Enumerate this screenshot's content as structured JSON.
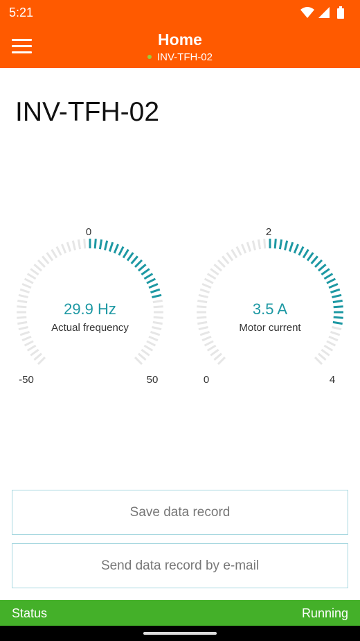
{
  "status_bar": {
    "time": "5:21",
    "icons": [
      "wifi-icon",
      "cell-signal-icon",
      "battery-icon"
    ]
  },
  "appbar": {
    "title": "Home",
    "subtitle": "INV-TFH-02",
    "menu_icon": "hamburger-menu-icon",
    "color": "#ff5a00",
    "connection_dot_color": "#9ccc3c"
  },
  "device": {
    "name": "INV-TFH-02"
  },
  "gauges": [
    {
      "id": "frequency",
      "value_text": "29.9 Hz",
      "label": "Actual frequency",
      "min": "-50",
      "max": "50",
      "mid": "0",
      "min_val": -50,
      "max_val": 50,
      "mid_val": 0,
      "value": 29.9
    },
    {
      "id": "current",
      "value_text": "3.5 A",
      "label": "Motor current",
      "min": "0",
      "max": "4",
      "mid": "2",
      "min_val": 0,
      "max_val": 4,
      "mid_val": 2,
      "value": 3.5
    }
  ],
  "colors": {
    "active_tick": "#1d98a3",
    "inactive_tick": "#e6e6e6",
    "status_green": "#44b029"
  },
  "actions": {
    "save": "Save data record",
    "send": "Send data record by e-mail"
  },
  "status": {
    "label": "Status",
    "value": "Running"
  }
}
